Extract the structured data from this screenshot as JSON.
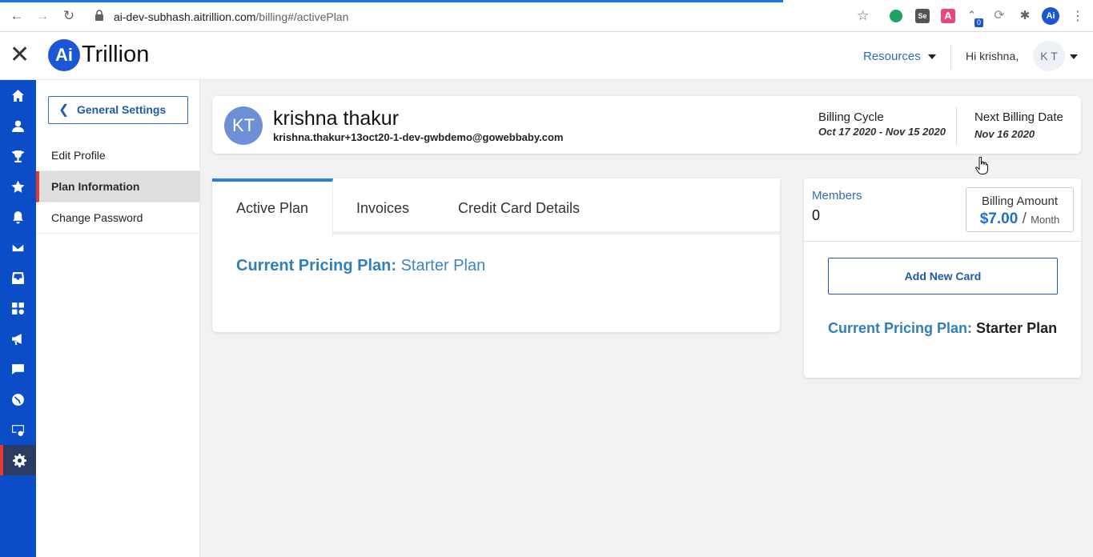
{
  "browser": {
    "url_host": "ai-dev-subhash.aitrillion.com",
    "url_path": "/billing#/activePlan",
    "extension_se": "Se",
    "extension_a": "A",
    "extension_badge": "0",
    "profile_initials": "Ai"
  },
  "header": {
    "logo_mark": "Ai",
    "logo_text": "Trillion",
    "resources_label": "Resources",
    "greeting": "Hi krishna,",
    "user_initials": "K T"
  },
  "rail": {
    "items": [
      "home-icon",
      "user-icon",
      "trophy-icon",
      "star-icon",
      "bell-icon",
      "mail-icon",
      "inbox-icon",
      "apps-icon",
      "megaphone-icon",
      "chat-icon",
      "globe-icon",
      "monitor-settings-icon",
      "gear-icon"
    ],
    "accent": "#0b4dc7"
  },
  "sidebar": {
    "back_label": "General Settings",
    "items": [
      {
        "label": "Edit Profile"
      },
      {
        "label": "Plan Information"
      },
      {
        "label": "Change Password"
      }
    ]
  },
  "profile": {
    "initials": "KT",
    "name": "krishna thakur",
    "email": "krishna.thakur+13oct20-1-dev-gwbdemo@gowebbaby.com",
    "billing_cycle_label": "Billing Cycle",
    "billing_cycle_value": "Oct 17 2020 - Nov 15 2020",
    "next_billing_label": "Next Billing Date",
    "next_billing_value": "Nov 16 2020"
  },
  "tabs": {
    "items": [
      {
        "label": "Active Plan"
      },
      {
        "label": "Invoices"
      },
      {
        "label": "Credit Card Details"
      }
    ],
    "current_plan_label": "Current Pricing Plan:",
    "current_plan_value": "Starter Plan"
  },
  "billing": {
    "members_label": "Members",
    "members_value": "0",
    "amount_label": "Billing Amount",
    "amount_value": "$7.00",
    "amount_sep": "/",
    "amount_period": "Month",
    "add_card_label": "Add New Card",
    "current_plan_label": "Current Pricing Plan:",
    "current_plan_value": "Starter Plan"
  }
}
